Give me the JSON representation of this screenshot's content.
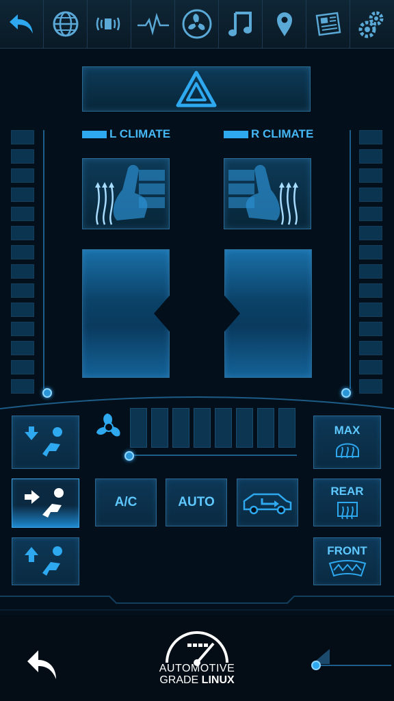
{
  "topbar": {
    "icons": [
      "back-arrow-icon",
      "globe-icon",
      "speaker-icon",
      "heartbeat-icon",
      "fan-icon",
      "music-note-icon",
      "location-pin-icon",
      "newspaper-icon",
      "settings-gears-icon"
    ]
  },
  "hazard": {
    "icon": "hazard-triangle-icon"
  },
  "left_climate": {
    "label": "L CLIMATE"
  },
  "right_climate": {
    "label": "R CLIMATE"
  },
  "airflow_buttons": [
    {
      "icon": "airflow-down-seat-icon"
    },
    {
      "icon": "airflow-forward-seat-icon",
      "active": true
    },
    {
      "icon": "airflow-up-seat-icon"
    }
  ],
  "controls": {
    "ac_label": "A/C",
    "auto_label": "AUTO",
    "recirc_icon": "car-recirculation-icon"
  },
  "defrost": {
    "max_label": "MAX",
    "rear_label": "REAR",
    "front_label": "FRONT"
  },
  "fan": {
    "icon": "fan-icon",
    "segments": 8
  },
  "bottom": {
    "logo_line1": "AUTOMOTIVE",
    "logo_line2a": "GRADE ",
    "logo_line2b": "LINUX"
  },
  "colors": {
    "accent": "#2ea8ef",
    "background": "#020a12"
  }
}
